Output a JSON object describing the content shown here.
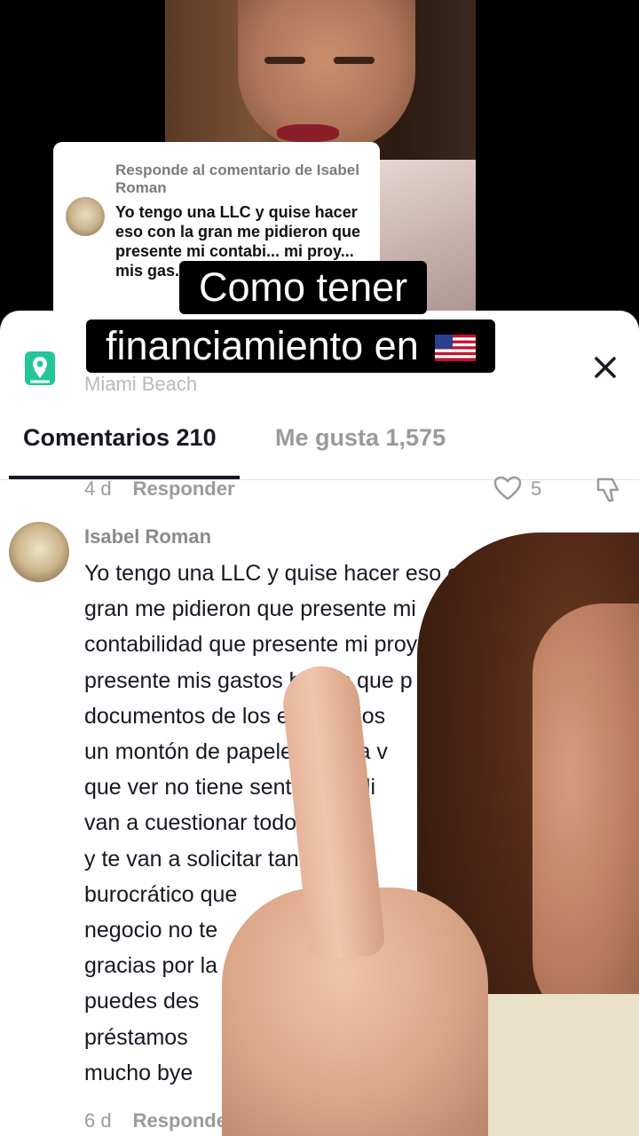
{
  "reply": {
    "header": "Responde al comentario de Isabel Roman",
    "body": "Yo tengo una LLC y quise hacer eso con la gran me pidieron que presente mi contabi... mi proy... mis gas..."
  },
  "caption": {
    "line1": "Como tener",
    "line2": "financiamiento en",
    "flag_icon": "us-flag-icon"
  },
  "sheet": {
    "location": "Miami Beach",
    "tabs": [
      {
        "label": "Comentarios 210",
        "active": true
      },
      {
        "label": "Me gusta 1,575",
        "active": false
      }
    ],
    "prev_comment": {
      "age": "4 d",
      "reply_label": "Responder",
      "likes": "5"
    },
    "comment": {
      "user": "Isabel Roman",
      "text": "Yo tengo una LLC y quise hacer eso con la\ngran me pidieron que presente mi\ncontabilidad que presente mi proyecto\npresente mis gastos brutos que p\ndocumentos de los empleados\nun montón de papeles que la v\nque ver no tiene sentido. pedi\nvan a cuestionar todo lo que\ny te van a solicitar tantos t\nburocrático que\nnegocio no te\ngracias por la\npuedes des\npréstamos\nmucho bye",
      "age": "6 d",
      "reply_label": "Responder"
    }
  },
  "colors": {
    "text_primary": "#161823",
    "text_secondary": "#9b9b9b",
    "location_icon_green": "#25c59a"
  }
}
